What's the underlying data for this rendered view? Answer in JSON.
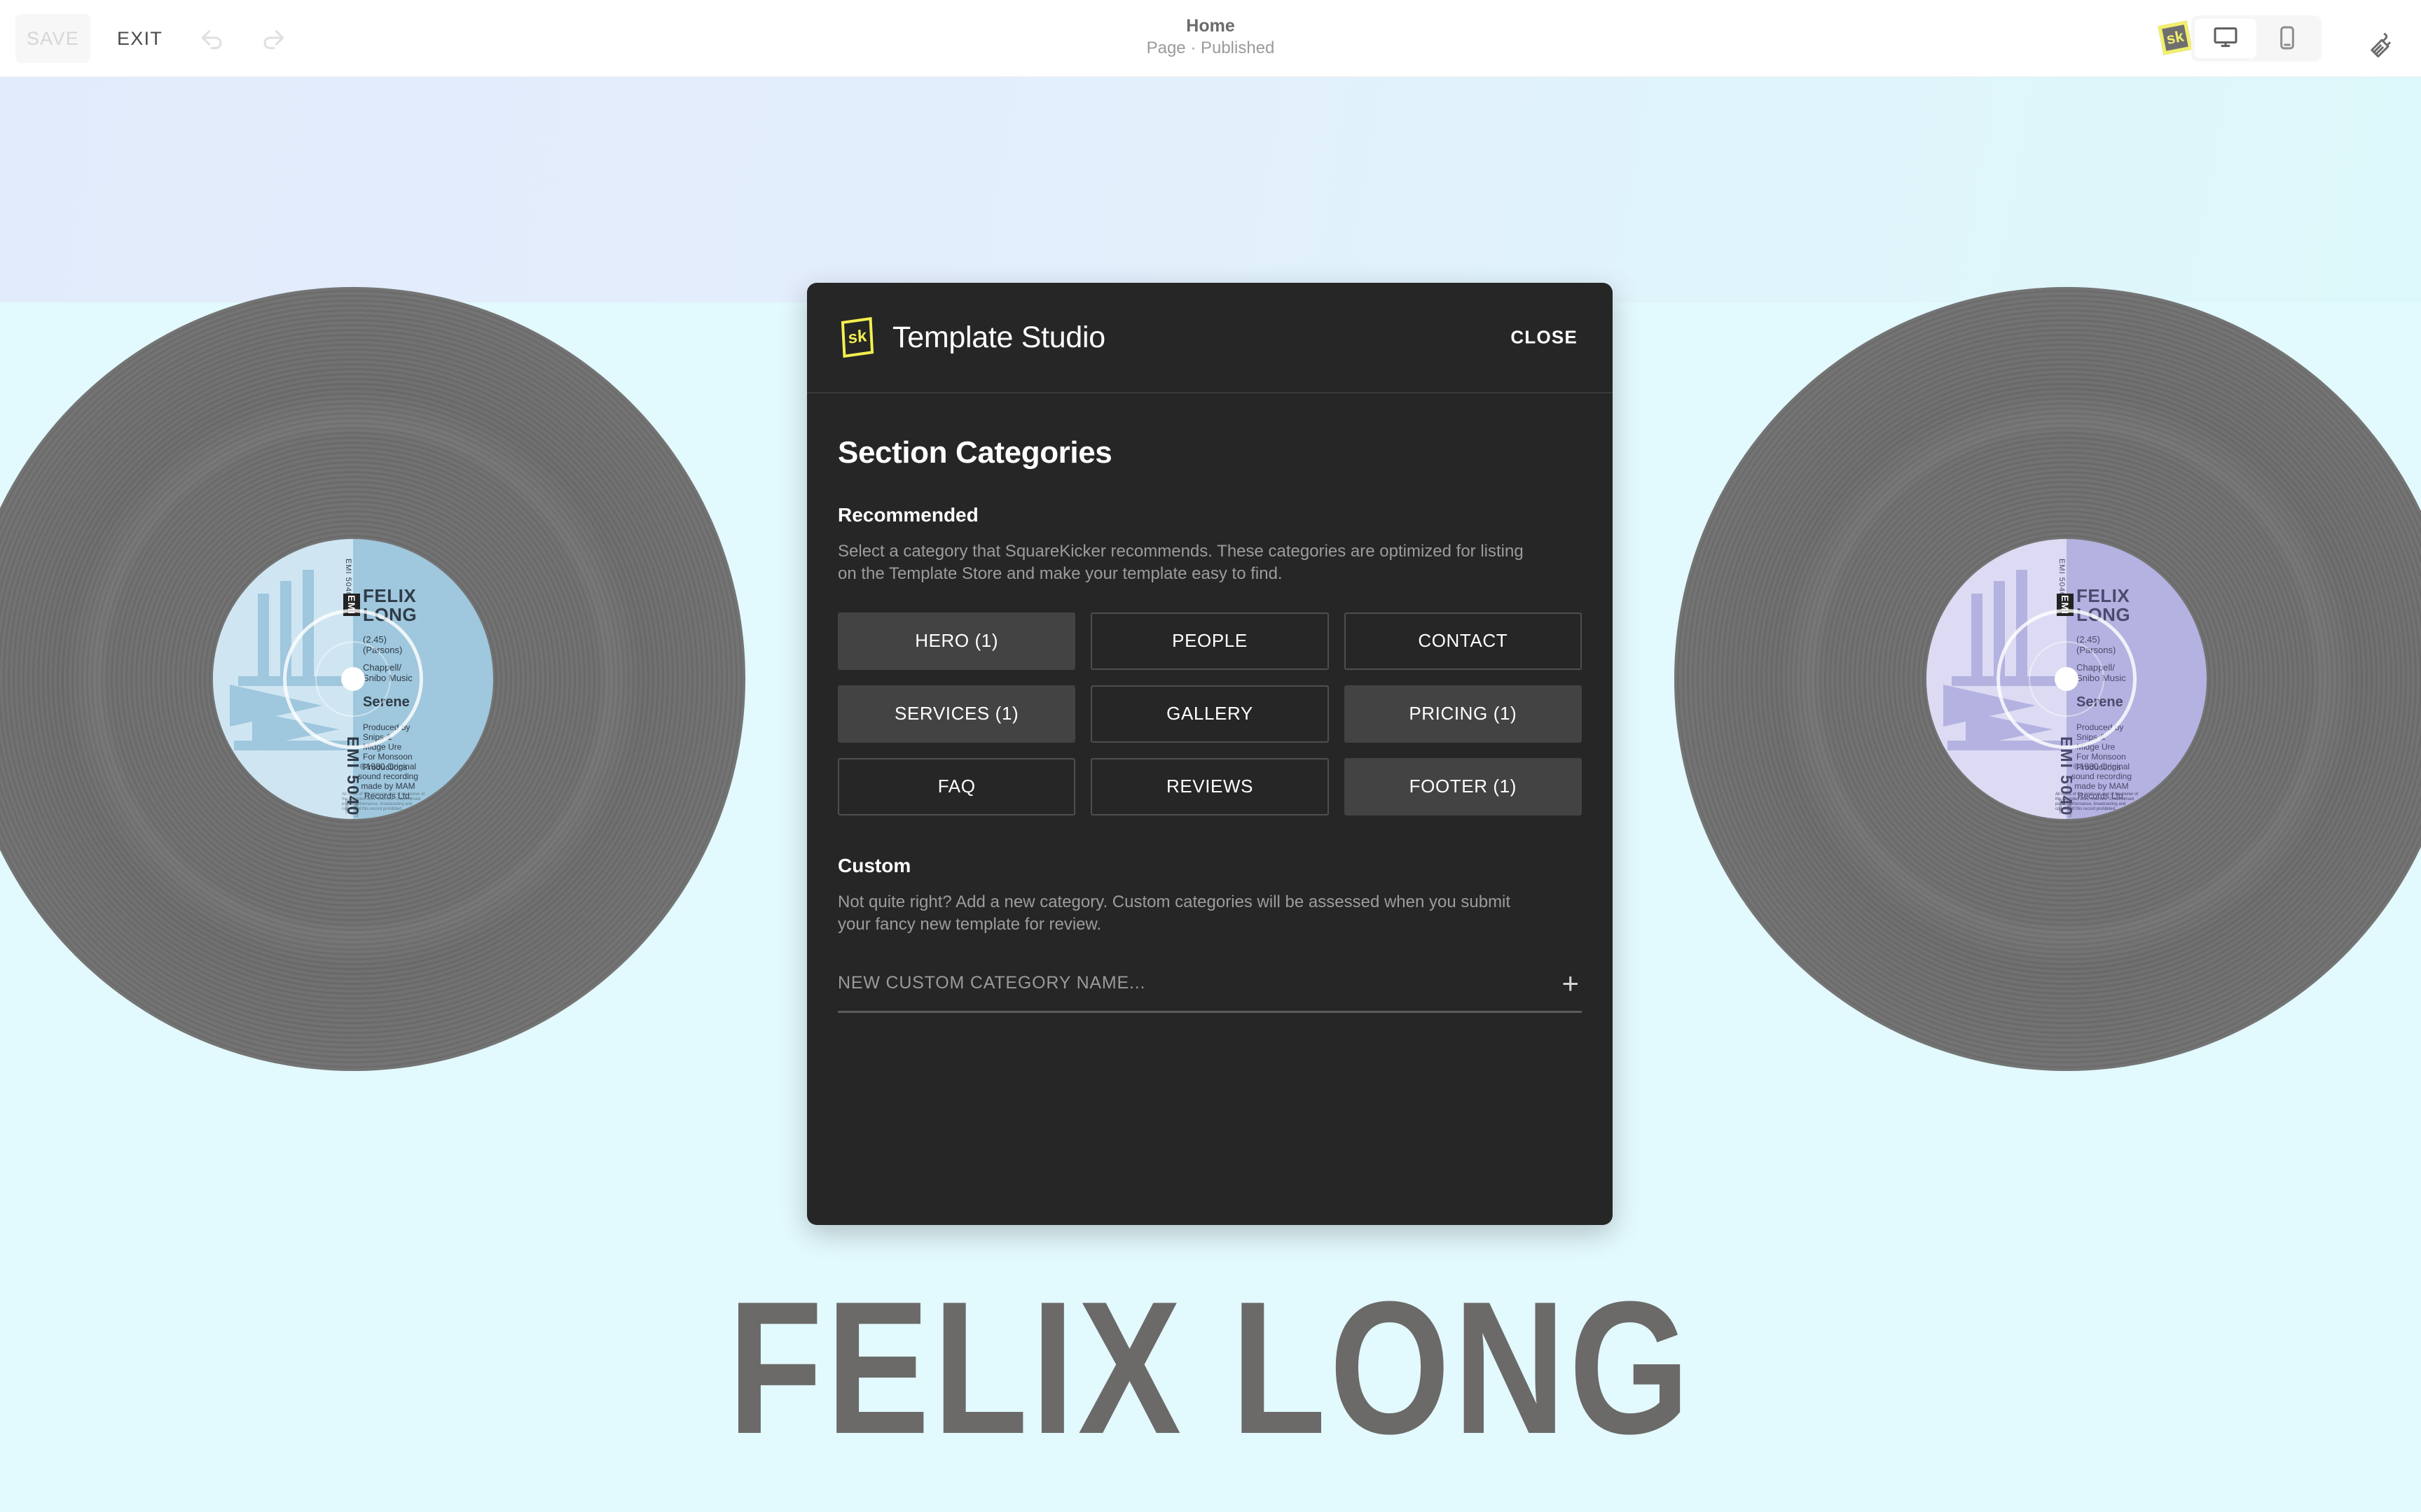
{
  "toolbar": {
    "save_label": "SAVE",
    "exit_label": "EXIT",
    "undo_icon": "undo-arrow-icon",
    "redo_icon": "redo-arrow-icon",
    "page_title": "Home",
    "page_status": "Page · Published",
    "sk_logo_text": "sk",
    "viewport_desktop_icon": "desktop-monitor-icon",
    "viewport_mobile_icon": "mobile-phone-icon",
    "viewport_selected": "desktop",
    "brush_icon": "paintbrush-icon"
  },
  "canvas": {
    "hero_title": "FELIX LONG",
    "hero_band_color": "#e2ebfb",
    "body_band_color": "#e2f9fd",
    "records": [
      {
        "label_color": "#9fc7dd",
        "label_color_light": "#cfe6f2",
        "catalog_side": "EMI\n5040B",
        "emi_mark": "EMI",
        "artist": "FELIX LONG",
        "duration": "(2.45)",
        "writer": "(Parsons)",
        "publisher": "Chappell/\nSnibo Music",
        "track": "Serene",
        "producer": "Produced by\nSnips &\nMidge Ure\nFor Monsoon\nProductions",
        "copyright": "℗1980 Original\nsound recording\nmade by MAM\nRecords Ltd.",
        "fine_print": "All rights of the producer and of the owner of the recorded work reserved. Unauthorised public performance, broadcasting and copying of this record prohibited.",
        "catalog_number": "EMI 5040",
        "made_in": "Made in\nGt. Britain"
      },
      {
        "label_color": "#b4b2e0",
        "label_color_light": "#dcdbf3",
        "catalog_side": "EMI\n5040B",
        "emi_mark": "EMI",
        "artist": "FELIX LONG",
        "duration": "(2.45)",
        "writer": "(Parsons)",
        "publisher": "Chappell/\nSnibo Music",
        "track": "Serene",
        "producer": "Produced by\nSnips &\nMidge Ure\nFor Monsoon\nProductions",
        "copyright": "℗1980 Original\nsound recording\nmade by MAM\nRecords Ltd.",
        "fine_print": "All rights of the producer and of the owner of the recorded work reserved. Unauthorised public performance, broadcasting and copying of this record prohibited.",
        "catalog_number": "EMI 5040",
        "made_in": "Made in\nGt. Britain"
      }
    ]
  },
  "modal": {
    "logo_text": "sk",
    "title": "Template Studio",
    "close_label": "CLOSE",
    "section_title": "Section Categories",
    "recommended": {
      "heading": "Recommended",
      "description": "Select a category that SquareKicker recommends. These categories are optimized for listing on the Template Store and make your template easy to find.",
      "categories": [
        {
          "label": "HERO (1)",
          "selected": true
        },
        {
          "label": "PEOPLE",
          "selected": false
        },
        {
          "label": "CONTACT",
          "selected": false
        },
        {
          "label": "SERVICES (1)",
          "selected": true
        },
        {
          "label": "GALLERY",
          "selected": false
        },
        {
          "label": "PRICING (1)",
          "selected": true
        },
        {
          "label": "FAQ",
          "selected": false
        },
        {
          "label": "REVIEWS",
          "selected": false
        },
        {
          "label": "FOOTER (1)",
          "selected": true
        }
      ]
    },
    "custom": {
      "heading": "Custom",
      "description": "Not quite right? Add a new category. Custom categories will be assessed when you submit your fancy new template for review.",
      "input_placeholder": "NEW CUSTOM CATEGORY NAME...",
      "input_value": "",
      "add_button_icon": "plus-icon"
    },
    "accent_color": "#f2ef4e",
    "background_color": "#262626"
  }
}
